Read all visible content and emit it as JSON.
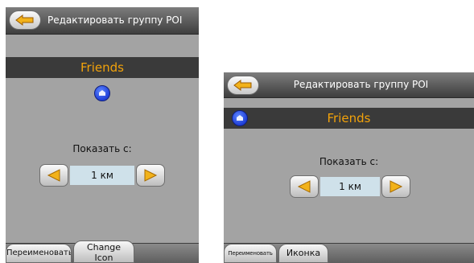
{
  "title": "Редактировать группу POI",
  "group_name": "Friends",
  "show_label": "Показать с:",
  "distance_value": "1 км",
  "portrait": {
    "rename_label": "Переименовать",
    "icon_label_line1": "Change",
    "icon_label_line2": "Icon"
  },
  "landscape": {
    "rename_label": "Переименовать",
    "icon_label": "Иконка"
  },
  "icons": {
    "back": "back-arrow-icon",
    "poi": "poi-group-icon",
    "decrease": "arrow-left-icon",
    "increase": "arrow-right-icon"
  },
  "colors": {
    "accent_orange": "#f2a20a",
    "arrow_yellow": "#f2b21a",
    "poi_blue": "#2a4fe0",
    "panel_gray": "#a3a3a3",
    "value_box": "#cfe1ea"
  }
}
